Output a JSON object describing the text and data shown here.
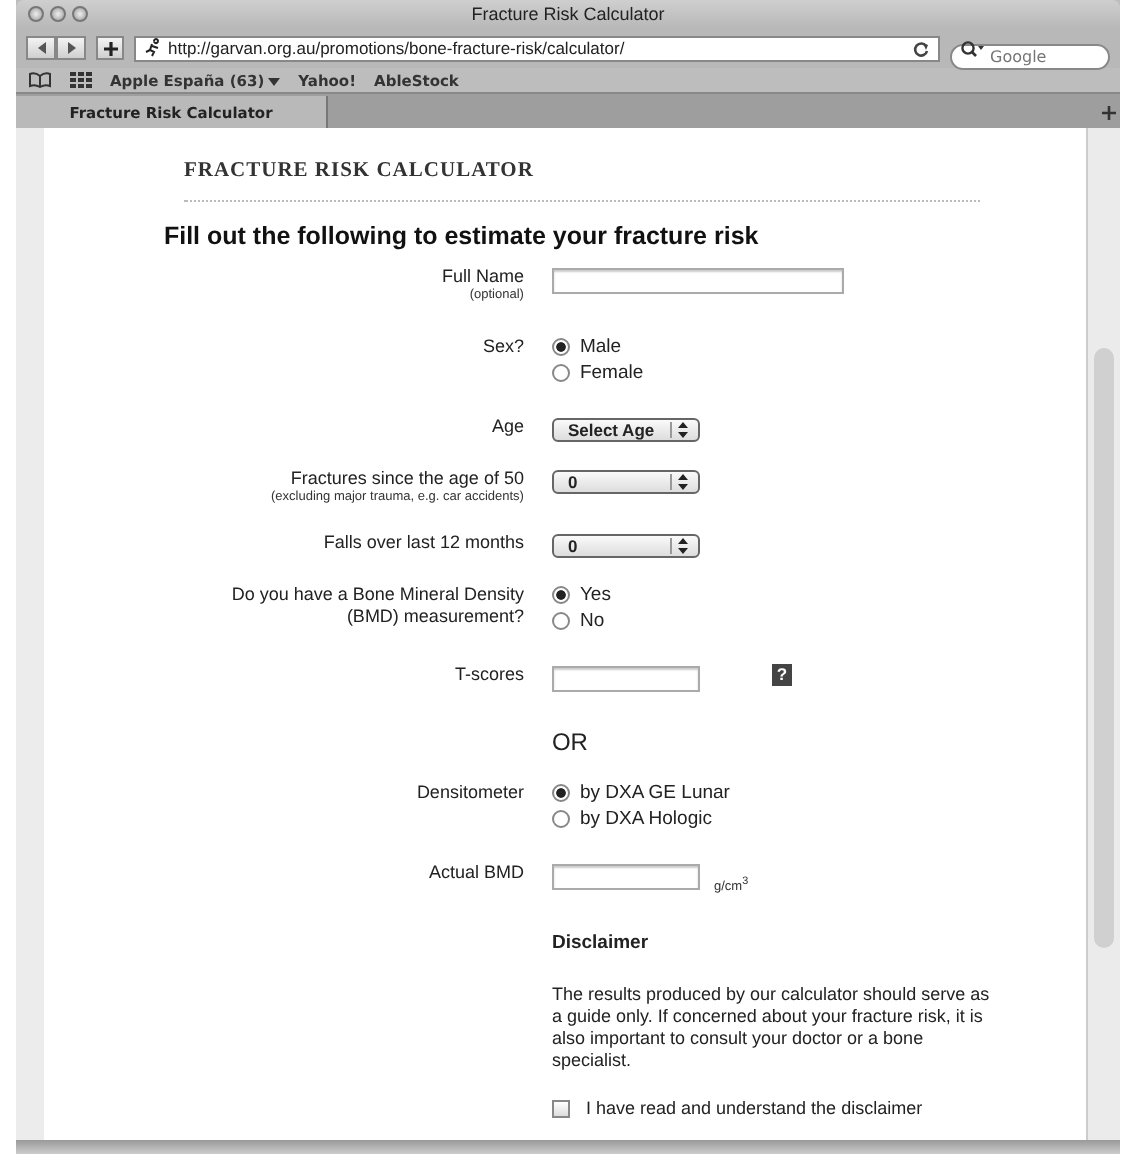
{
  "window": {
    "title": "Fracture Risk Calculator"
  },
  "toolbar": {
    "address": "http://garvan.org.au/promotions/bone-fracture-risk/calculator/",
    "search_placeholder": "Google"
  },
  "bookmarks": [
    {
      "label": "Apple España (63)",
      "menu": true
    },
    {
      "label": "Yahoo!",
      "menu": false
    },
    {
      "label": "AbleStock",
      "menu": false
    }
  ],
  "tabs": [
    {
      "label": "Fracture Risk Calculator",
      "selected": true
    }
  ],
  "page": {
    "site_title": "FRACTURE RISK CALCULATOR",
    "heading": "Fill out the following to estimate your fracture risk",
    "rows": [
      {
        "kind": "text",
        "label": "Full Name",
        "sublabel": "(optional)",
        "wide": true
      },
      {
        "kind": "radio",
        "label": "Sex?",
        "options": [
          {
            "label": "Male",
            "selected": true
          },
          {
            "label": "Female",
            "selected": false
          }
        ]
      },
      {
        "kind": "select",
        "label": "Age",
        "value": "Select Age"
      },
      {
        "kind": "select",
        "label": "Fractures since the age of 50",
        "sublabel": "(excluding major trauma, e.g. car accidents)",
        "value": "0"
      },
      {
        "kind": "select",
        "label": "Falls over last 12 months",
        "value": "0"
      },
      {
        "kind": "radio",
        "label": "Do you have a Bone Mineral Density (BMD) measurement?",
        "options": [
          {
            "label": "Yes",
            "selected": true
          },
          {
            "label": "No",
            "selected": false
          }
        ]
      },
      {
        "kind": "text",
        "label": "T-scores",
        "help": "?",
        "wide": false
      },
      {
        "kind": "note",
        "text": "OR"
      },
      {
        "kind": "radio",
        "label": "Densitometer",
        "options": [
          {
            "label": "by DXA GE Lunar",
            "selected": true
          },
          {
            "label": "by DXA Hologic",
            "selected": false
          }
        ]
      },
      {
        "kind": "text",
        "label": "Actual BMD",
        "unit": "g/cm$^{3}$",
        "wide": false
      },
      {
        "kind": "heading",
        "text": "Disclaimer"
      },
      {
        "kind": "paragraph",
        "text": "The results produced by our calculator should serve as a guide only. If concerned about your fracture risk, it is also important to consult your doctor or a bone specialist."
      },
      {
        "kind": "checkbox",
        "label": "I have read and understand the disclaimer",
        "checked": false
      }
    ]
  }
}
